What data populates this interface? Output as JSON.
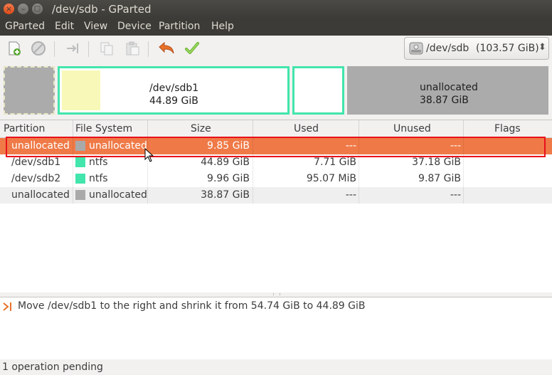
{
  "window": {
    "title": "/dev/sdb - GParted",
    "close_glyph": "×",
    "min_glyph": "–",
    "max_glyph": "□"
  },
  "menubar": {
    "items": [
      "GParted",
      "Edit",
      "View",
      "Device",
      "Partition",
      "Help"
    ]
  },
  "toolbar": {
    "icons": [
      "new-partition-icon",
      "delete-icon",
      "resize-move-icon",
      "copy-icon",
      "paste-icon",
      "undo-icon",
      "apply-icon"
    ],
    "device_name": "/dev/sdb",
    "device_size": "(103.57 GiB)",
    "combo_arrows": "⬍"
  },
  "partition_map": {
    "sdb1_name": "/dev/sdb1",
    "sdb1_size": "44.89 GiB",
    "unalloc_name": "unallocated",
    "unalloc_size": "38.87 GiB",
    "sdb1_used_fraction": 0.17,
    "colors": {
      "ntfs": "#42e5ac",
      "unallocated": "#a9a9a9",
      "used": "#f8f8b8"
    }
  },
  "table": {
    "headers": [
      "Partition",
      "File System",
      "Size",
      "Used",
      "Unused",
      "Flags"
    ],
    "rows": [
      {
        "partition": "unallocated",
        "fs": "unallocated",
        "size": "9.85 GiB",
        "used": "---",
        "unused": "---",
        "flags": "",
        "fs_color": "#a9a9a9"
      },
      {
        "partition": "/dev/sdb1",
        "fs": "ntfs",
        "size": "44.89 GiB",
        "used": "7.71 GiB",
        "unused": "37.18 GiB",
        "flags": "",
        "fs_color": "#42e5ac"
      },
      {
        "partition": "/dev/sdb2",
        "fs": "ntfs",
        "size": "9.96 GiB",
        "used": "95.07 MiB",
        "unused": "9.87 GiB",
        "flags": "",
        "fs_color": "#42e5ac"
      },
      {
        "partition": "unallocated",
        "fs": "unallocated",
        "size": "38.87 GiB",
        "used": "---",
        "unused": "---",
        "flags": "",
        "fs_color": "#a9a9a9"
      }
    ],
    "selected_row": 0,
    "selection_color": "#ef7a47"
  },
  "operations": {
    "items": [
      "Move /dev/sdb1 to the right and shrink it from 54.74 GiB to 44.89 GiB"
    ]
  },
  "status": {
    "text": "1 operation pending"
  }
}
